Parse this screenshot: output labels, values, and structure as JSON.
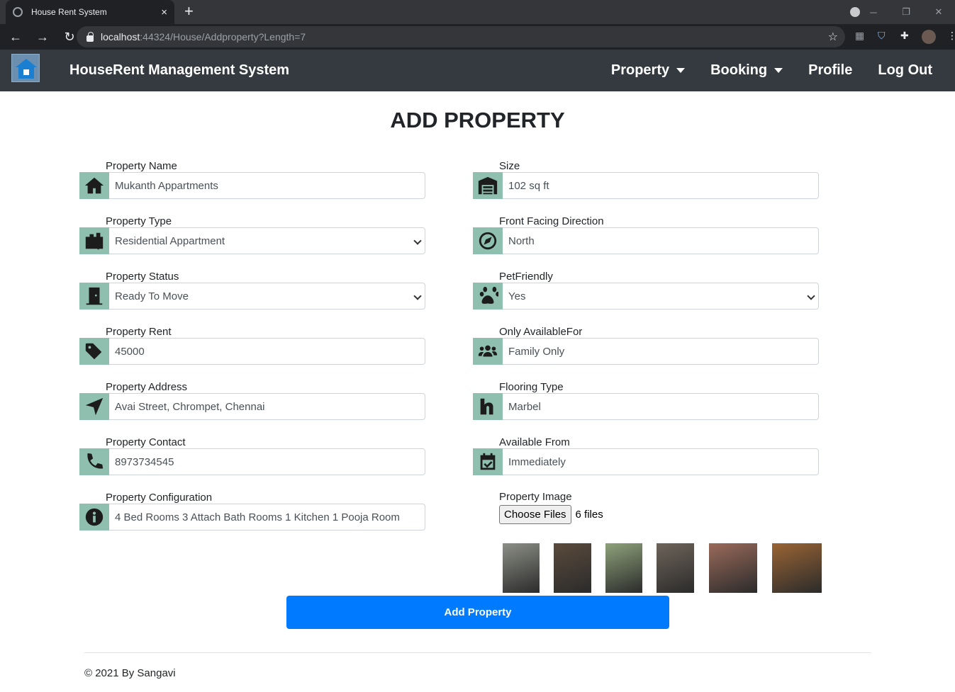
{
  "browser": {
    "tab_title": "House Rent System",
    "tab_close": "×",
    "new_tab": "+",
    "url_host": "localhost",
    "url_rest": ":44324/House/Addproperty?Length=7"
  },
  "navbar": {
    "brand": "HouseRent Management System",
    "links": [
      "Property",
      "Booking",
      "Profile",
      "Log Out"
    ]
  },
  "page": {
    "title": "ADD PROPERTY"
  },
  "left_fields": [
    {
      "label": "Property Name",
      "value": "Mukanth Appartments",
      "icon": "home-icon",
      "type": "input"
    },
    {
      "label": "Property Type",
      "value": "Residential Appartment",
      "icon": "building-icon",
      "type": "select"
    },
    {
      "label": "Property Status",
      "value": "Ready To Move",
      "icon": "door-icon",
      "type": "select"
    },
    {
      "label": "Property Rent",
      "value": "45000",
      "icon": "tags-icon",
      "type": "input"
    },
    {
      "label": "Property Address",
      "value": "Avai Street, Chrompet, Chennai",
      "icon": "location-arrow-icon",
      "type": "input"
    },
    {
      "label": "Property Contact",
      "value": "8973734545",
      "icon": "phone-icon",
      "type": "input"
    },
    {
      "label": "Property Configuration",
      "value": "4 Bed Rooms 3 Attach Bath Rooms 1 Kitchen 1 Pooja Room",
      "icon": "info-icon",
      "type": "input"
    }
  ],
  "right_fields": [
    {
      "label": "Size",
      "value": "102 sq ft",
      "icon": "warehouse-icon",
      "type": "input"
    },
    {
      "label": "Front Facing Direction",
      "value": "North",
      "icon": "compass-icon",
      "type": "input"
    },
    {
      "label": "PetFriendly",
      "value": "Yes",
      "icon": "paw-icon",
      "type": "select"
    },
    {
      "label": "Only AvailableFor",
      "value": "Family Only",
      "icon": "users-icon",
      "type": "input"
    },
    {
      "label": "Flooring Type",
      "value": "Marbel",
      "icon": "floor-icon",
      "type": "input"
    },
    {
      "label": "Available From",
      "value": "Immediately",
      "icon": "calendar-check-icon",
      "type": "input"
    }
  ],
  "image_field": {
    "label": "Property Image",
    "button": "Choose Files",
    "count": "6 files"
  },
  "thumbnails": [
    {
      "name": "thumb-building-exterior",
      "color": "#8c8f86"
    },
    {
      "name": "thumb-kitchen",
      "color": "#5a4a3c"
    },
    {
      "name": "thumb-landscape",
      "color": "#8ea27a"
    },
    {
      "name": "thumb-bathroom",
      "color": "#6e645a"
    },
    {
      "name": "thumb-aerial-pool",
      "color": "#9a6a5a"
    },
    {
      "name": "thumb-bedroom",
      "color": "#9a6434"
    }
  ],
  "submit_label": "Add Property",
  "footer": "© 2021 By Sangavi"
}
